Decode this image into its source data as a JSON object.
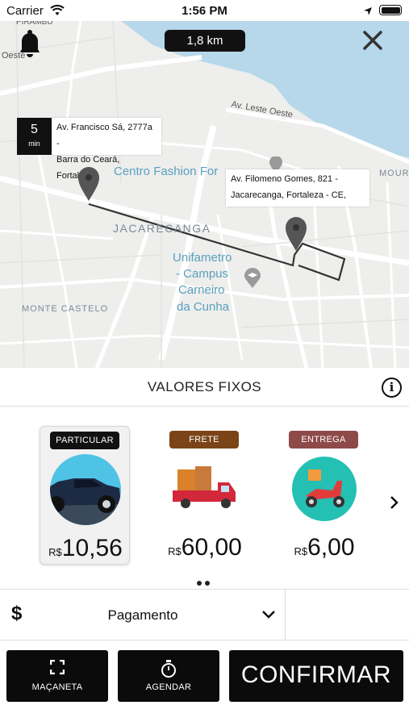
{
  "status_bar": {
    "carrier": "Carrier",
    "time": "1:56 PM"
  },
  "map": {
    "distance": "1,8 km",
    "eta_value": "5",
    "eta_unit": "min",
    "origin_line1": "Av. Francisco Sá, 2777a -",
    "origin_line2": "Barra do Ceará, Fortaleza -",
    "dest_line1": "Av. Filomeno Gomes, 821 -",
    "dest_line2": "Jacarecanga, Fortaleza - CE,",
    "labels": {
      "pirambu": "PIRAMBU",
      "oeste": "Oeste",
      "av_leste_oeste": "Av. Leste Oeste",
      "centro_fashion": "Centro Fashion For",
      "moura": "MOUR",
      "jacarecanga": "JACARECANGA",
      "unifametro_1": "Unifametro",
      "unifametro_2": "- Campus",
      "unifametro_3": "Carneiro",
      "unifametro_4": "da Cunha",
      "monte_castelo": "MONTE CASTELO"
    }
  },
  "section_title": "VALORES FIXOS",
  "options": [
    {
      "badge": "PARTICULAR",
      "currency": "R$",
      "price": "10,56",
      "badge_color": "#111111",
      "icon": "car-icon",
      "selected": true
    },
    {
      "badge": "FRETE",
      "currency": "R$",
      "price": "60,00",
      "badge_color": "#7a4418",
      "icon": "truck-icon",
      "selected": false
    },
    {
      "badge": "ENTREGA",
      "currency": "R$",
      "price": "6,00",
      "badge_color": "#8e4a49",
      "icon": "scooter-icon",
      "selected": false
    }
  ],
  "payment": {
    "symbol": "$",
    "label": "Pagamento"
  },
  "buttons": {
    "maçaneta": "MAÇANETA",
    "agendar": "AGENDAR",
    "confirmar": "CONFIRMAR"
  },
  "colors": {
    "water": "#b7d7ea",
    "map_bg": "#eeeeec",
    "route": "#333333"
  }
}
